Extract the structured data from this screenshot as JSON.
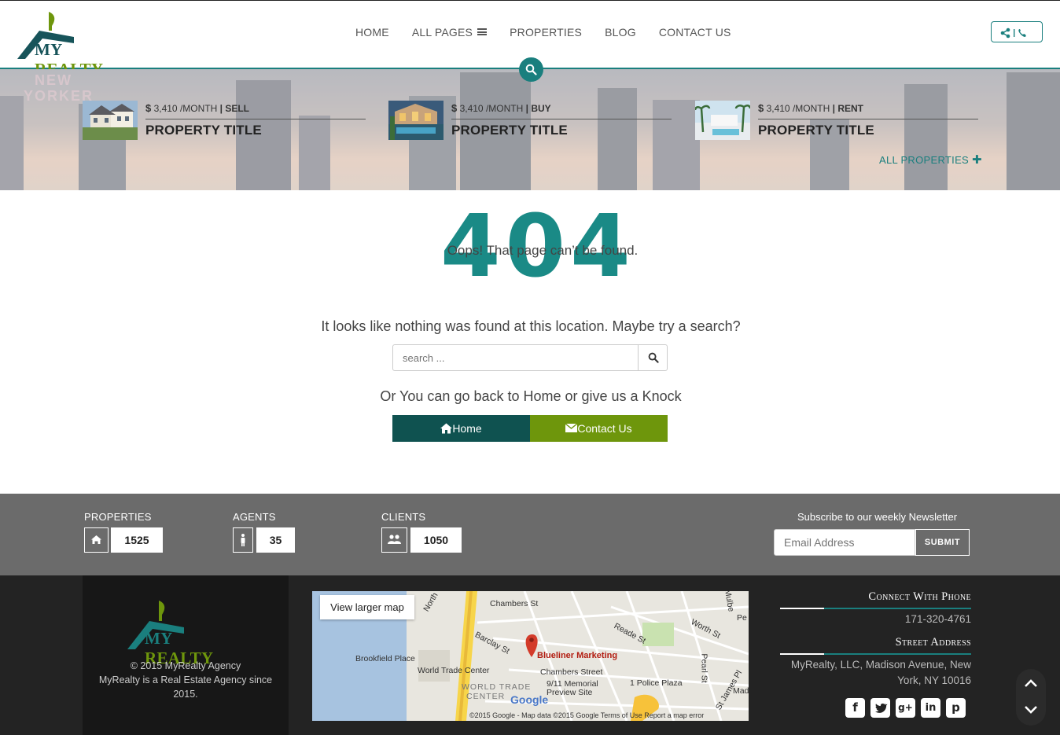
{
  "brand": {
    "my": "MY",
    "realty": "REALTY"
  },
  "nav": {
    "items": [
      "HOME",
      "ALL PAGES",
      "PROPERTIES",
      "BLOG",
      "CONTACT US"
    ]
  },
  "header": {
    "contact_icons": "share-icon | phone-icon"
  },
  "banner": {
    "properties": [
      {
        "currency": "$",
        "price": "3,410",
        "period": "/MONTH",
        "sep": "|",
        "type": "SELL",
        "title": "PROPERTY TITLE"
      },
      {
        "currency": "$",
        "price": "3,410",
        "period": "/MONTH",
        "sep": "|",
        "type": "BUY",
        "title": "PROPERTY TITLE"
      },
      {
        "currency": "$",
        "price": "3,410",
        "period": "/MONTH",
        "sep": "|",
        "type": "RENT",
        "title": "PROPERTY TITLE"
      }
    ],
    "all_properties": "ALL PROPERTIES",
    "neon": [
      "NEW",
      "YORKER"
    ]
  },
  "error": {
    "code": "404",
    "headline": "Oops! That page can’t be found.",
    "message": "It looks like nothing was found at this location. Maybe try a search?",
    "search_placeholder": "search ...",
    "or_back": "Or You can go back to Home or give us a Knock",
    "home_label": "Home",
    "contact_label": "Contact Us"
  },
  "stats": {
    "properties_label": "PROPERTIES",
    "properties_value": "1525",
    "agents_label": "AGENTS",
    "agents_value": "35",
    "clients_label": "CLIENTS",
    "clients_value": "1050",
    "newsletter_title": "Subscribe to our weekly Newsletter",
    "email_placeholder": "Email Address",
    "submit_label": "SUBMIT"
  },
  "footer": {
    "copyright": "© 2015 MyRealty Agency",
    "tagline": "MyRealty is a Real Estate Agency since 2015.",
    "map": {
      "larger": "View larger map",
      "labels": [
        "Chambers St",
        "Blueliner Marketing",
        "Brookfield Place",
        "World Trade Center",
        "Chambers Street",
        "9/11 Memorial",
        "Preview Site",
        "1 Police Plaza",
        "Reade St",
        "Worth St",
        "Barclay St",
        "Pearl St",
        "St James Pl",
        "North",
        "Mulbe",
        "Pe",
        "Mad",
        "WORLD TRADE",
        "CENTER",
        "Google"
      ],
      "footer": "©2015 Google - Map data ©2015 Google   Terms of Use   Report a map error"
    },
    "connect_title": "Connect With Phone",
    "phone": "171-320-4761",
    "address_title": "Street Address",
    "address": "MyRealty, LLC, Madison Avenue, New York, NY 10016",
    "social": [
      "facebook-icon",
      "twitter-icon",
      "google-plus-icon",
      "linkedin-icon",
      "pinterest-icon"
    ]
  },
  "colors": {
    "teal": "#1a7f7e",
    "dark_teal": "#0f5250",
    "green": "#6e960c",
    "stats_bg": "#6b6b6b",
    "footer_bg": "#232323"
  }
}
